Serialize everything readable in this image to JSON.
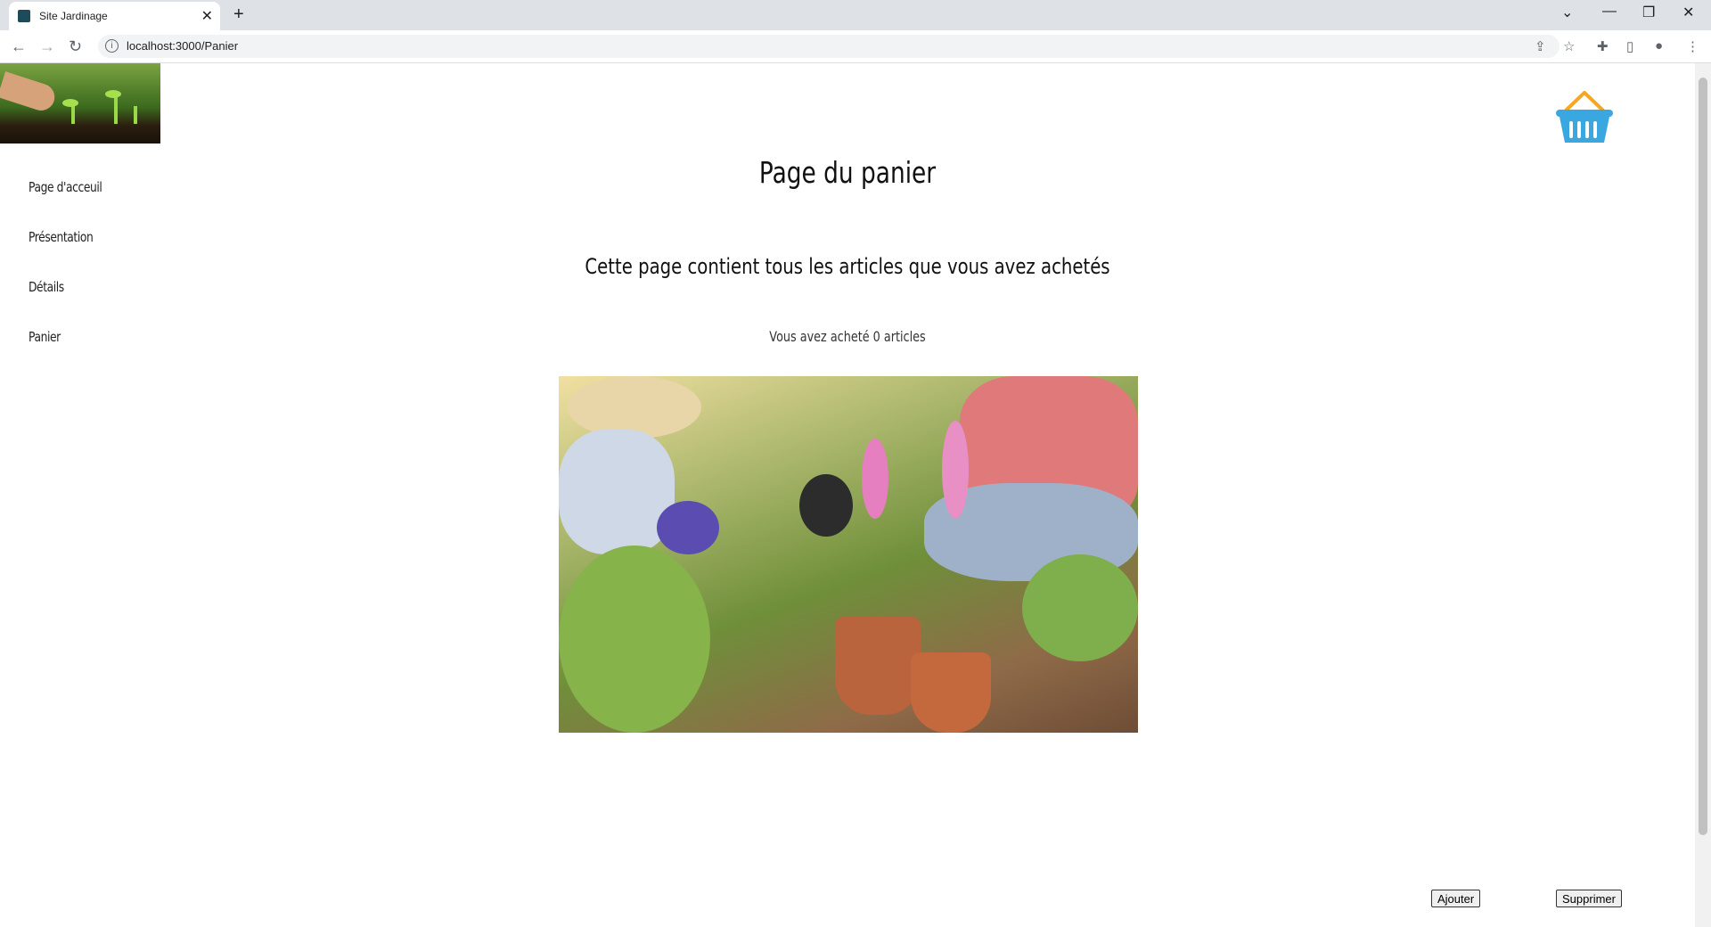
{
  "browser": {
    "tab_title": "Site Jardinage",
    "new_tab_icon": "plus-icon",
    "url": "localhost:3000/Panier"
  },
  "sidebar": {
    "items": [
      {
        "label": "Page d'acceuil"
      },
      {
        "label": "Présentation"
      },
      {
        "label": "Détails"
      },
      {
        "label": "Panier"
      }
    ]
  },
  "main": {
    "title": "Page du panier",
    "subtitle": "Cette page contient tous les articles que vous avez achetés",
    "count_text": "Vous avez acheté 0 articles"
  },
  "actions": {
    "add_label": "Ajouter",
    "remove_label": "Supprimer"
  },
  "colors": {
    "basket_blue": "#3aa7e0",
    "basket_handle": "#f5a623"
  }
}
